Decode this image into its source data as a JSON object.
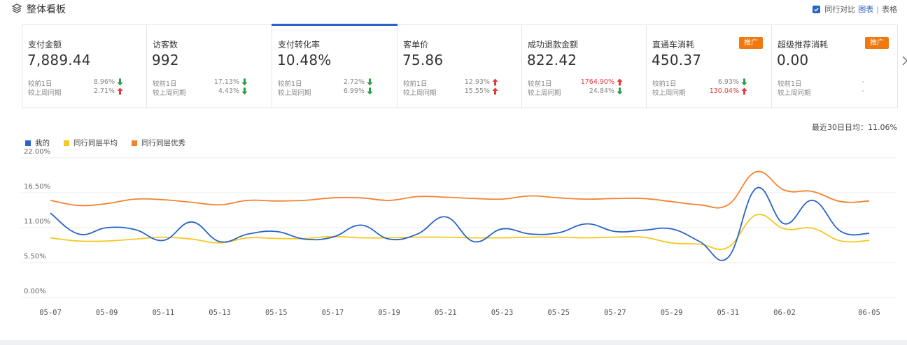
{
  "header": {
    "title": "整体看板",
    "compare_label": "同行对比",
    "view_chart": "图表",
    "separator": "|",
    "view_table": "表格"
  },
  "cards": [
    {
      "name": "支付金额",
      "value": "7,889.44",
      "day_label": "较前1日",
      "day_pct": "8.96%",
      "day_dir": "down",
      "week_label": "较上周同期",
      "week_pct": "2.71%",
      "week_dir": "up",
      "active": false,
      "promo": ""
    },
    {
      "name": "访客数",
      "value": "992",
      "day_label": "较前1日",
      "day_pct": "17.13%",
      "day_dir": "down",
      "week_label": "较上周同期",
      "week_pct": "4.43%",
      "week_dir": "down",
      "active": false,
      "promo": ""
    },
    {
      "name": "支付转化率",
      "value": "10.48%",
      "day_label": "较前1日",
      "day_pct": "2.72%",
      "day_dir": "down",
      "week_label": "较上周同期",
      "week_pct": "6.99%",
      "week_dir": "down",
      "active": true,
      "promo": ""
    },
    {
      "name": "客单价",
      "value": "75.86",
      "day_label": "较前1日",
      "day_pct": "12.93%",
      "day_dir": "up",
      "week_label": "较上周同期",
      "week_pct": "15.55%",
      "week_dir": "up",
      "active": false,
      "promo": ""
    },
    {
      "name": "成功退款金额",
      "value": "822.42",
      "day_label": "较前1日",
      "day_pct": "1764.90%",
      "day_dir": "up",
      "day_red": true,
      "week_label": "较上周同期",
      "week_pct": "24.84%",
      "week_dir": "down",
      "active": false,
      "promo": ""
    },
    {
      "name": "直通车消耗",
      "value": "450.37",
      "day_label": "较前1日",
      "day_pct": "6.93%",
      "day_dir": "down",
      "week_label": "较上周同期",
      "week_pct": "130.04%",
      "week_dir": "up",
      "week_red": true,
      "active": false,
      "promo": "推广"
    },
    {
      "name": "超级推荐消耗",
      "value": "0.00",
      "day_label": "较前1日",
      "day_pct": "-",
      "day_dir": "",
      "week_label": "较上周同期",
      "week_pct": "-",
      "week_dir": "",
      "active": false,
      "promo": "推广"
    }
  ],
  "avg_note": "最近30日日均：11.06%",
  "colors": {
    "mine": "#2864c8",
    "avg": "#f5c823",
    "excellent": "#f5822f",
    "up": "#e23b3b",
    "down": "#2a9e47"
  },
  "chart_data": {
    "type": "line",
    "categories": [
      "05-07",
      "05-08",
      "05-09",
      "05-10",
      "05-11",
      "05-12",
      "05-13",
      "05-14",
      "05-15",
      "05-16",
      "05-17",
      "05-18",
      "05-19",
      "05-20",
      "05-21",
      "05-22",
      "05-23",
      "05-24",
      "05-25",
      "05-26",
      "05-27",
      "05-28",
      "05-29",
      "05-30",
      "05-31",
      "06-01",
      "06-02",
      "06-03",
      "06-04",
      "06-05"
    ],
    "tick_labels": [
      "05-07",
      "05-09",
      "05-11",
      "05-13",
      "05-15",
      "05-17",
      "05-19",
      "05-21",
      "05-23",
      "05-25",
      "05-27",
      "05-29",
      "05-31",
      "06-02",
      "06-05"
    ],
    "y_ticks": [
      "0.00%",
      "5.50%",
      "11.00%",
      "16.50%",
      "22.00%"
    ],
    "ylim": [
      0,
      22
    ],
    "series": [
      {
        "name": "我的",
        "color": "#2864c8",
        "values": [
          13.3,
          10.0,
          11.0,
          10.7,
          9.0,
          11.9,
          8.8,
          10.0,
          10.4,
          9.2,
          9.5,
          11.4,
          9.2,
          10.0,
          12.7,
          8.8,
          10.8,
          10.0,
          10.2,
          11.6,
          10.4,
          10.6,
          10.8,
          8.8,
          6.3,
          17.2,
          11.6,
          15.3,
          10.4,
          10.1
        ]
      },
      {
        "name": "同行同层平均",
        "color": "#f5c823",
        "values": [
          9.4,
          8.9,
          8.9,
          9.2,
          9.5,
          9.2,
          8.6,
          9.4,
          9.3,
          9.3,
          9.6,
          9.4,
          9.4,
          9.5,
          9.5,
          9.4,
          9.4,
          9.5,
          9.5,
          9.4,
          9.5,
          9.5,
          8.6,
          8.4,
          7.9,
          13.0,
          10.8,
          10.9,
          8.9,
          9.0
        ]
      },
      {
        "name": "同行同层优秀",
        "color": "#f5822f",
        "values": [
          15.3,
          14.5,
          14.8,
          15.5,
          15.4,
          15.0,
          14.6,
          15.3,
          15.2,
          15.3,
          15.7,
          15.7,
          15.3,
          15.9,
          15.8,
          15.6,
          15.5,
          16.0,
          15.7,
          15.5,
          15.6,
          15.6,
          15.1,
          14.6,
          14.6,
          19.8,
          16.9,
          16.7,
          15.1,
          15.2
        ]
      }
    ]
  }
}
